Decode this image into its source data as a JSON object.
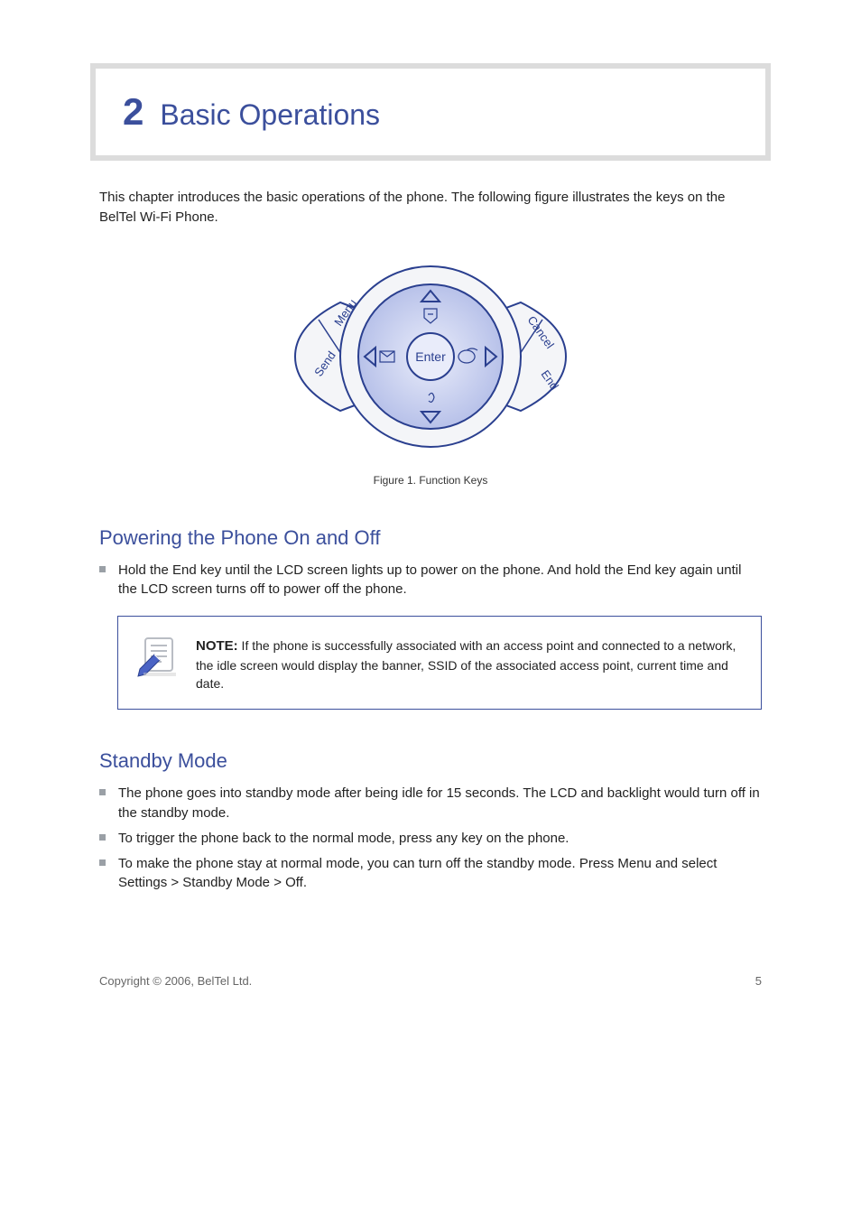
{
  "chapter": {
    "number": "2",
    "title": "Basic Operations"
  },
  "intro": "This chapter introduces the basic operations of the phone. The following figure illustrates the keys on the BelTel Wi-Fi Phone.",
  "keypad": {
    "up_label": "up",
    "down_label": "down",
    "left_label": "left",
    "right_label": "right",
    "enter_label": "Enter",
    "menu_label": "Menu",
    "send_label": "Send",
    "cancel_label": "Cancel",
    "end_label": "End"
  },
  "figure_caption": "Figure 1. Function Keys",
  "section_power": {
    "title": "Powering the Phone On and Off",
    "bullet1": "Hold the End key until the LCD screen lights up to power on the phone. And hold the End key again until the LCD screen turns off to power off the phone."
  },
  "note": {
    "heading_prefix": "NOTE:",
    "text": " If the phone is successfully associated with an access point and connected to a network, the idle screen would display the banner, SSID of the associated access point, current time and date."
  },
  "section_standby": {
    "title": "Standby Mode",
    "bullet1": "The phone goes into standby mode after being idle for 15 seconds. The LCD and backlight would turn off in the standby mode.",
    "bullet2": "To trigger the phone back to the normal mode, press any key on the phone.",
    "bullet3": "To make the phone stay at normal mode, you can turn off the standby mode. Press Menu and select Settings > Standby Mode > Off."
  },
  "footer": {
    "copyright": "Copyright © 2006, BelTel Ltd.",
    "page": "5"
  }
}
